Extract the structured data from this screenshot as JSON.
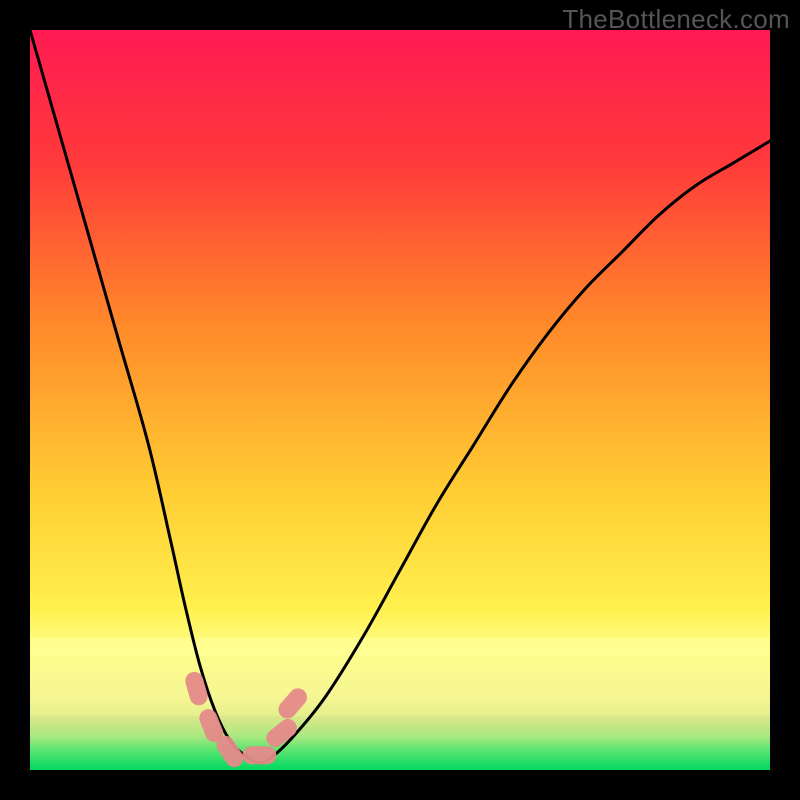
{
  "watermark": "TheBottleneck.com",
  "colors": {
    "frame_bg": "#000000",
    "grad_top": "#ff1a53",
    "grad_mid1": "#ff6a2a",
    "grad_mid2": "#ffcc33",
    "grad_band": "#ffff8a",
    "grad_band_dark": "#e8e880",
    "grad_bottom": "#00e066",
    "curve": "#000000",
    "marker_fill": "#e58a8a",
    "marker_stroke": "#e58a8a"
  },
  "chart_data": {
    "type": "line",
    "title": "",
    "xlabel": "",
    "ylabel": "",
    "xlim": [
      0,
      100
    ],
    "ylim": [
      0,
      100
    ],
    "series": [
      {
        "name": "bottleneck-curve",
        "x": [
          0,
          4,
          8,
          12,
          16,
          19,
          21,
          23,
          25,
          27,
          29,
          31,
          33,
          36,
          40,
          45,
          50,
          55,
          60,
          65,
          70,
          75,
          80,
          85,
          90,
          95,
          100
        ],
        "values": [
          100,
          86,
          72,
          58,
          44,
          31,
          22,
          14,
          8,
          4,
          2,
          1,
          2,
          5,
          10,
          18,
          27,
          36,
          44,
          52,
          59,
          65,
          70,
          75,
          79,
          82,
          85
        ]
      }
    ],
    "markers": {
      "name": "highlighted-points",
      "points": [
        {
          "x": 22.5,
          "y": 11
        },
        {
          "x": 24.5,
          "y": 6
        },
        {
          "x": 27.0,
          "y": 2.5
        },
        {
          "x": 31.0,
          "y": 2.0
        },
        {
          "x": 34.0,
          "y": 5.0
        },
        {
          "x": 35.5,
          "y": 9.0
        }
      ]
    },
    "annotations": []
  }
}
